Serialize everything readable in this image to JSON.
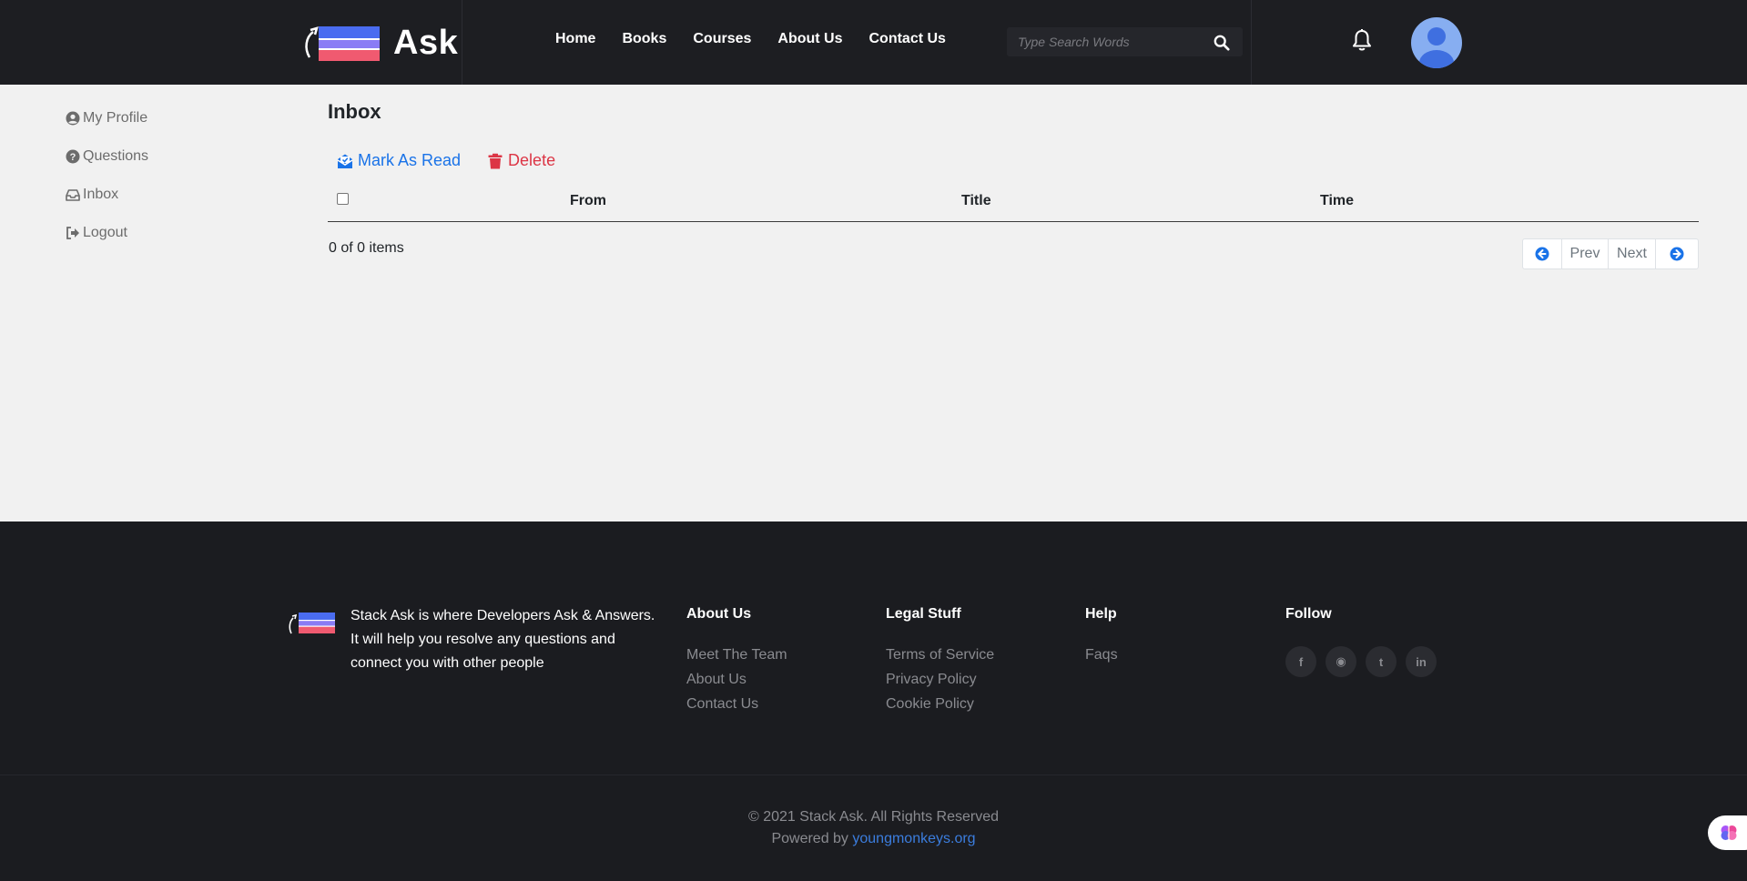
{
  "header": {
    "logo_text": "Ask",
    "nav": [
      "Home",
      "Books",
      "Courses",
      "About Us",
      "Contact Us"
    ],
    "search_placeholder": "Type Search Words"
  },
  "sidebar": {
    "items": [
      {
        "label": "My Profile",
        "icon": "user-circle-icon"
      },
      {
        "label": "Questions",
        "icon": "question-circle-icon"
      },
      {
        "label": "Inbox",
        "icon": "inbox-icon"
      },
      {
        "label": "Logout",
        "icon": "sign-out-icon"
      }
    ]
  },
  "main": {
    "title": "Inbox",
    "mark_read_label": "Mark As Read",
    "delete_label": "Delete",
    "columns": [
      "From",
      "Title",
      "Time"
    ],
    "items_count": "0 of 0 items",
    "prev_label": "Prev",
    "next_label": "Next"
  },
  "footer": {
    "description": "Stack Ask is where Developers Ask & Answers. It will help you resolve any questions and connect you with other people",
    "columns": [
      {
        "title": "About Us",
        "links": [
          "Meet The Team",
          "About Us",
          "Contact Us"
        ]
      },
      {
        "title": "Legal Stuff",
        "links": [
          "Terms of Service",
          "Privacy Policy",
          "Cookie Policy"
        ]
      },
      {
        "title": "Help",
        "links": [
          "Faqs"
        ]
      }
    ],
    "follow_title": "Follow",
    "social": [
      {
        "icon": "facebook-icon",
        "glyph": "f"
      },
      {
        "icon": "github-icon",
        "glyph": "◉"
      },
      {
        "icon": "twitter-icon",
        "glyph": "t"
      },
      {
        "icon": "linkedin-icon",
        "glyph": "in"
      }
    ],
    "copyright": "© 2021 Stack Ask. All Rights Reserved",
    "powered_prefix": "Powered by ",
    "powered_link": "youngmonkeys.org"
  },
  "colors": {
    "header_bg": "#1d1e22",
    "footer_bg": "#1b1c20",
    "accent_blue": "#1a73e8",
    "danger_red": "#dc3545",
    "page_bg": "#f1f1f1"
  }
}
